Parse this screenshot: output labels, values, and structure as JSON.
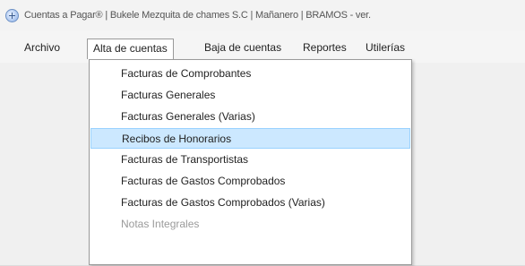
{
  "window": {
    "title": "Cuentas a Pagar® | Bukele Mezquita de chames S.C | Mañanero | BRAMOS - ver."
  },
  "menubar": {
    "items": [
      {
        "label": "Archivo"
      },
      {
        "label": "Alta de cuentas"
      },
      {
        "label": "Baja de cuentas"
      },
      {
        "label": "Reportes"
      },
      {
        "label": "Utilerías"
      }
    ]
  },
  "dropdown": {
    "items": [
      {
        "label": "Facturas de Comprobantes",
        "state": "normal"
      },
      {
        "label": "Facturas Generales",
        "state": "normal"
      },
      {
        "label": "Facturas Generales (Varias)",
        "state": "normal"
      },
      {
        "label": "Recibos de Honorarios",
        "state": "highlighted"
      },
      {
        "label": "Facturas de Transportistas",
        "state": "normal"
      },
      {
        "label": "Facturas de Gastos Comprobados",
        "state": "normal"
      },
      {
        "label": "Facturas de Gastos Comprobados (Varias)",
        "state": "normal"
      },
      {
        "label": "Notas Integrales",
        "state": "disabled"
      }
    ]
  },
  "colors": {
    "highlight_bg": "#cce8ff",
    "highlight_border": "#99d1ff",
    "disabled_text": "#9a9a9a"
  }
}
